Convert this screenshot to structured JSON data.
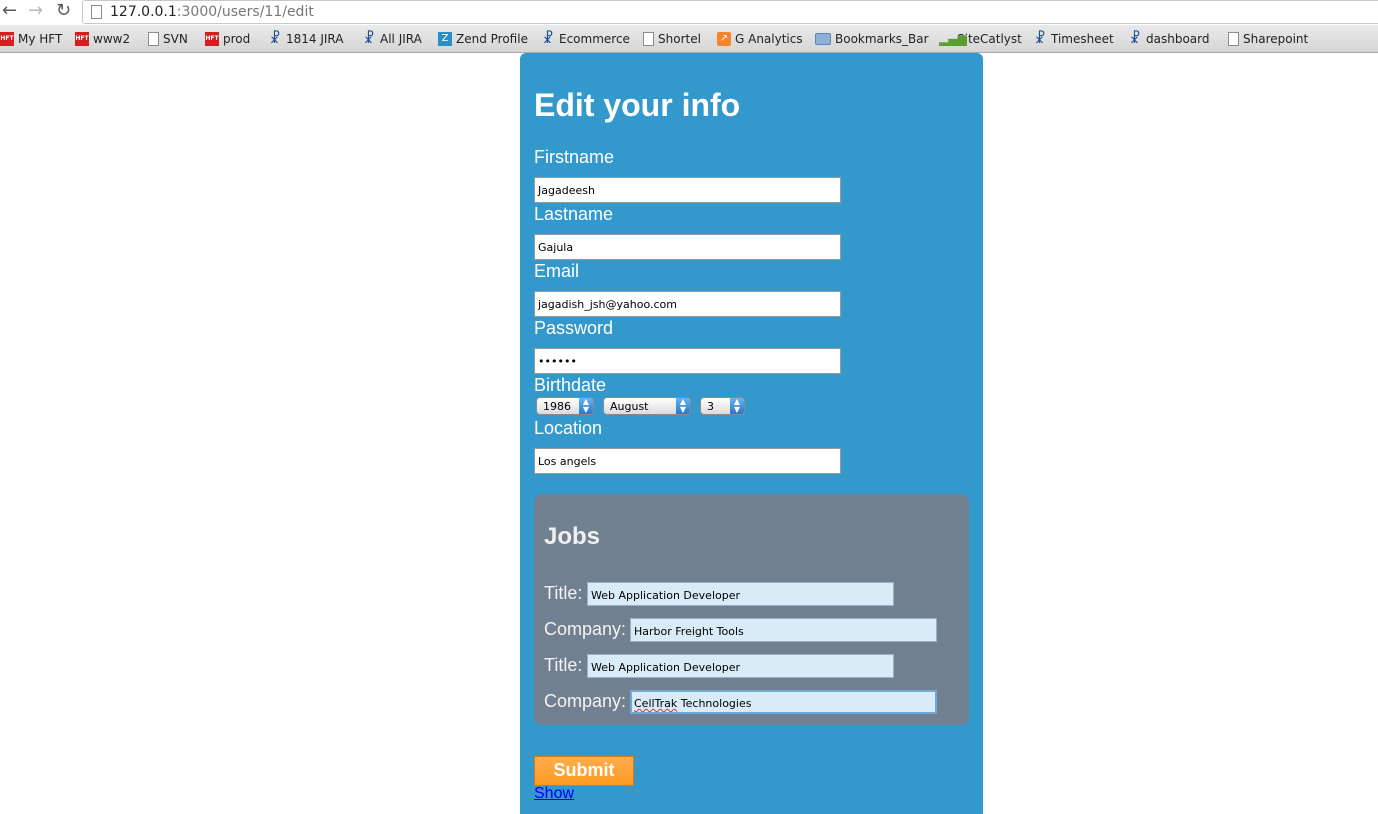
{
  "browser": {
    "url_host": "127.0.0.1",
    "url_rest": ":3000/users/11/edit",
    "bookmarks": [
      {
        "label": "My HFT",
        "icon": "hft-logo-icon"
      },
      {
        "label": "www2",
        "icon": "hft-logo-icon"
      },
      {
        "label": "SVN",
        "icon": "document-icon"
      },
      {
        "label": "prod",
        "icon": "hft-logo-icon"
      },
      {
        "label": "1814 JIRA",
        "icon": "jira-icon"
      },
      {
        "label": "All JIRA",
        "icon": "jira-icon"
      },
      {
        "label": "Zend Profile",
        "icon": "zend-icon"
      },
      {
        "label": "Ecommerce",
        "icon": "jira-icon"
      },
      {
        "label": "Shortel",
        "icon": "document-icon"
      },
      {
        "label": "G Analytics",
        "icon": "analytics-icon"
      },
      {
        "label": "Bookmarks_Bar",
        "icon": "folder-icon"
      },
      {
        "label": "SiteCatlyst",
        "icon": "bar-chart-icon"
      },
      {
        "label": "Timesheet",
        "icon": "jira-icon"
      },
      {
        "label": "dashboard",
        "icon": "jira-icon"
      },
      {
        "label": "Sharepoint",
        "icon": "document-icon"
      }
    ]
  },
  "form": {
    "title": "Edit your info",
    "firstname_label": "Firstname",
    "firstname_value": "Jagadeesh",
    "lastname_label": "Lastname",
    "lastname_value": "Gajula",
    "email_label": "Email",
    "email_value": "jagadish_jsh@yahoo.com",
    "password_label": "Password",
    "password_value": "••••••",
    "birthdate_label": "Birthdate",
    "birth_year": "1986",
    "birth_month": "August",
    "birth_day": "3",
    "location_label": "Location",
    "location_value": "Los angels"
  },
  "jobs": {
    "title": "Jobs",
    "entries": [
      {
        "title_label": "Title:",
        "title_value": "Web Application Developer",
        "company_label": "Company:",
        "company_value": "Harbor Freight Tools"
      },
      {
        "title_label": "Title:",
        "title_value": "Web Application Developer",
        "company_label": "Company:",
        "company_value_misspelled": "CellTrak",
        "company_value_rest": " Technologies"
      }
    ]
  },
  "actions": {
    "submit_label": "Submit",
    "show_link": "Show"
  },
  "colors": {
    "panel": "#3399cc",
    "jobs_panel": "#708090",
    "submit": "#ff9a22"
  }
}
